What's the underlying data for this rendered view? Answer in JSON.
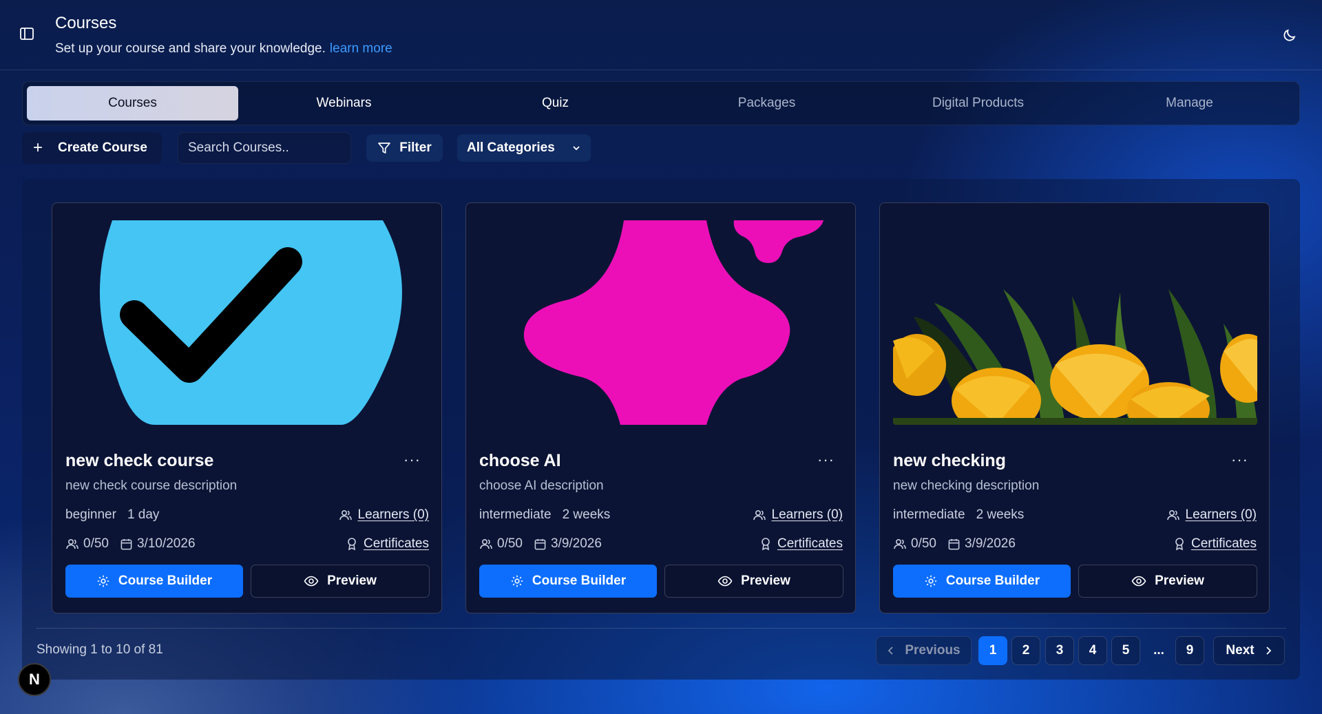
{
  "header": {
    "title": "Courses",
    "subtitle": "Set up your course and share your knowledge.",
    "learn_more": "learn more"
  },
  "tabs": [
    {
      "label": "Courses",
      "active": true
    },
    {
      "label": "Webinars"
    },
    {
      "label": "Quiz"
    },
    {
      "label": "Packages"
    },
    {
      "label": "Digital Products"
    },
    {
      "label": "Manage"
    }
  ],
  "toolbar": {
    "create_label": "Create Course",
    "search_placeholder": "Search Courses..",
    "filter_label": "Filter",
    "category_selected": "All Categories"
  },
  "courses": [
    {
      "title": "new check course",
      "description": "new check course description",
      "level": "beginner",
      "duration": "1 day",
      "learners_link": "Learners (0)",
      "capacity": "0/50",
      "date": "3/10/2026",
      "certificates_link": "Certificates",
      "builder_label": "Course Builder",
      "preview_label": "Preview",
      "thumbnail": "checkmark-illustration"
    },
    {
      "title": "choose AI",
      "description": "choose AI description",
      "level": "intermediate",
      "duration": "2 weeks",
      "learners_link": "Learners (0)",
      "capacity": "0/50",
      "date": "3/9/2026",
      "certificates_link": "Certificates",
      "builder_label": "Course Builder",
      "preview_label": "Preview",
      "thumbnail": "magenta-shape-illustration"
    },
    {
      "title": "new checking",
      "description": "new checking description",
      "level": "intermediate",
      "duration": "2 weeks",
      "learners_link": "Learners (0)",
      "capacity": "0/50",
      "date": "3/9/2026",
      "certificates_link": "Certificates",
      "builder_label": "Course Builder",
      "preview_label": "Preview",
      "thumbnail": "yellow-tulips-photo"
    }
  ],
  "pagination": {
    "summary": "Showing 1 to 10 of 81",
    "previous": "Previous",
    "next": "Next",
    "pages": [
      "1",
      "2",
      "3",
      "4",
      "5"
    ],
    "ellipsis": "...",
    "last": "9",
    "current": "1"
  },
  "badge": "N",
  "colors": {
    "accent": "#0d6efd",
    "link": "#3b9bff",
    "card_bg": "#0c1435"
  }
}
